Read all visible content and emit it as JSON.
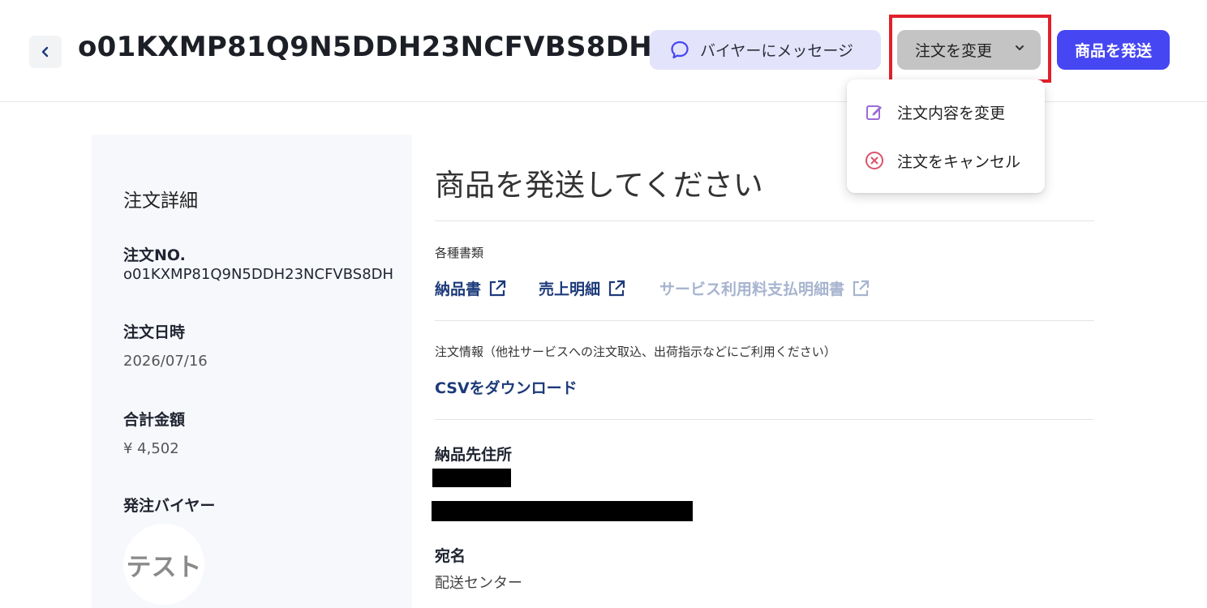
{
  "header": {
    "order_id": "o01KXMP81Q9N5DDH23NCFVBS8DH",
    "message_button": "バイヤーにメッセージ",
    "change_button": "注文を変更",
    "ship_button": "商品を発送"
  },
  "dropdown": {
    "items": [
      {
        "label": "注文内容を変更",
        "icon": "edit-icon",
        "color": "#9b6bd6"
      },
      {
        "label": "注文をキャンセル",
        "icon": "cancel-circle-icon",
        "color": "#d9536b"
      }
    ]
  },
  "sidebar": {
    "heading": "注文詳細",
    "order_no_label": "注文NO.",
    "order_no_value": "o01KXMP81Q9N5DDH23NCFVBS8DH",
    "date_label": "注文日時",
    "date_value": "2026/07/16",
    "total_label": "合計金額",
    "total_value": "¥ 4,502",
    "buyer_label": "発注バイヤー",
    "buyer_avatar_text": "テスト"
  },
  "main": {
    "title": "商品を発送してください",
    "documents_label": "各種書類",
    "documents": [
      {
        "label": "納品書",
        "enabled": true
      },
      {
        "label": "売上明細",
        "enabled": true
      },
      {
        "label": "サービス利用料支払明細書",
        "enabled": false
      }
    ],
    "order_info_label": "注文情報（他社サービスへの注文取込、出荷指示などにご利用ください）",
    "csv_link": "CSVをダウンロード",
    "address_label": "納品先住所",
    "recipient_label": "宛名",
    "recipient_value": "配送センター"
  },
  "colors": {
    "accent": "#4646f2",
    "link": "#1d3a7a",
    "highlight_border": "#e0202a"
  }
}
